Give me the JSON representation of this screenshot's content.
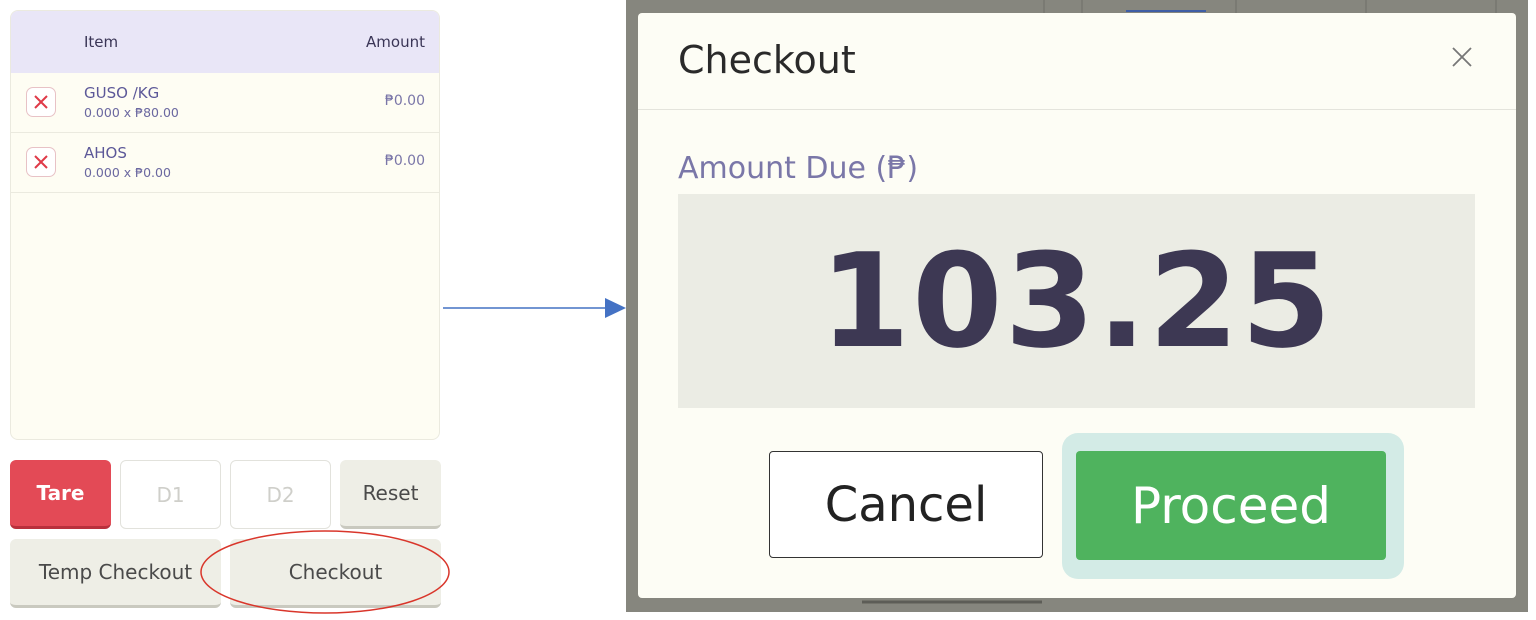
{
  "cart": {
    "headers": {
      "item": "Item",
      "amount": "Amount"
    },
    "items": [
      {
        "name": "GUSO /KG",
        "detail": "0.000 x ₱80.00",
        "amount": "₱0.00"
      },
      {
        "name": "AHOS",
        "detail": "0.000 x ₱0.00",
        "amount": "₱0.00"
      }
    ]
  },
  "buttons": {
    "tare": "Tare",
    "d1": "D1",
    "d2": "D2",
    "reset": "Reset",
    "temp_checkout": "Temp Checkout",
    "checkout": "Checkout"
  },
  "modal": {
    "title": "Checkout",
    "close_icon": "x-icon",
    "amount_due_label": "Amount Due (₱)",
    "amount_due_value": "103.25",
    "cancel": "Cancel",
    "proceed": "Proceed"
  },
  "colors": {
    "tare": "#e34a56",
    "proceed": "#4fb35e",
    "annotation": "#d9362b",
    "arrow": "#4472c4"
  }
}
